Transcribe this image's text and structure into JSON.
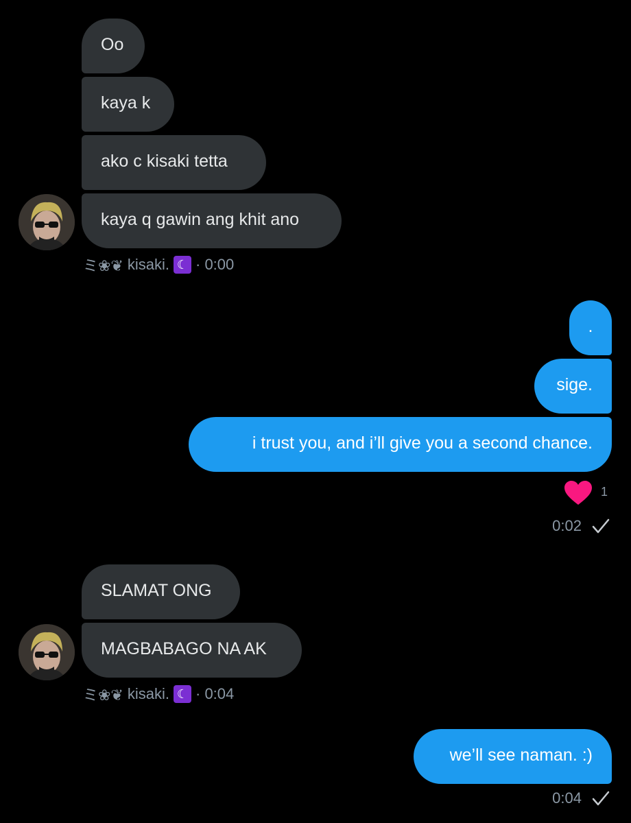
{
  "conversation": {
    "group1": {
      "messages": [
        "Oo",
        "kaya k",
        "ako c kisaki tetta",
        "kaya q gawin ang khit ano"
      ],
      "sender_prefix": "ミ❀❦",
      "sender_name": "kisaki.",
      "sender_emoji": "☾",
      "time": "· 0:00"
    },
    "sent1": {
      "messages": [
        ".",
        "sige.",
        "i trust you, and i’ll give you a second chance."
      ],
      "reaction_count": "1",
      "time": "0:02"
    },
    "group2": {
      "messages": [
        "SLAMAT ONG",
        "MAGBABAGO NA AK"
      ],
      "sender_prefix": "ミ❀❦",
      "sender_name": "kisaki.",
      "sender_emoji": "☾",
      "time": "· 0:04"
    },
    "sent2": {
      "messages": [
        "we’ll see naman. :)"
      ],
      "time": "0:04"
    }
  },
  "colors": {
    "background": "#000000",
    "received_bubble": "#2f3336",
    "sent_bubble": "#1d9bf0",
    "meta_text": "#8b98a5",
    "heart": "#f91880"
  },
  "icons": {
    "reaction": "heart-icon",
    "read_receipt": "checkmark-icon",
    "avatar": "user-avatar"
  }
}
